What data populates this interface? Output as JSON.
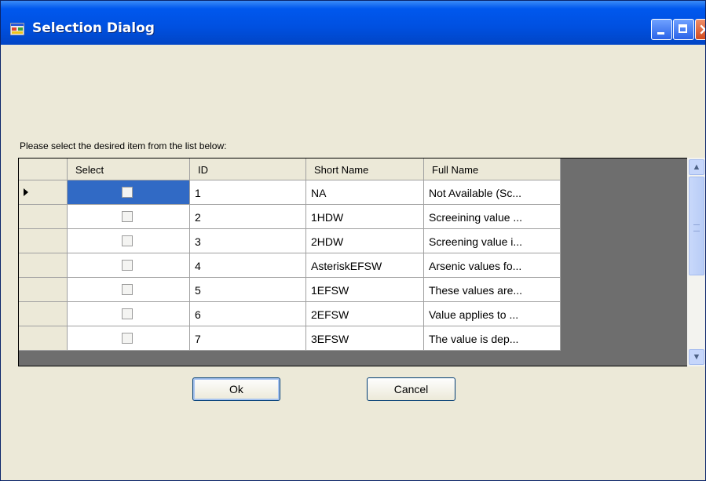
{
  "window": {
    "title": "Selection Dialog",
    "icon": "application-icon"
  },
  "prompt": "Please select the desired item from the list below:",
  "grid": {
    "columns": [
      "Select",
      "ID",
      "Short Name",
      "Full Name"
    ],
    "rows": [
      {
        "selected_row": true,
        "checked": false,
        "id": "1",
        "short_name": "NA",
        "full_name": "Not Available (Sc..."
      },
      {
        "selected_row": false,
        "checked": false,
        "id": "2",
        "short_name": "1HDW",
        "full_name": "Screeining value ..."
      },
      {
        "selected_row": false,
        "checked": false,
        "id": "3",
        "short_name": "2HDW",
        "full_name": "Screening value i..."
      },
      {
        "selected_row": false,
        "checked": false,
        "id": "4",
        "short_name": "AsteriskEFSW",
        "full_name": "Arsenic values fo..."
      },
      {
        "selected_row": false,
        "checked": false,
        "id": "5",
        "short_name": "1EFSW",
        "full_name": "These values are..."
      },
      {
        "selected_row": false,
        "checked": false,
        "id": "6",
        "short_name": "2EFSW",
        "full_name": "Value applies to ..."
      },
      {
        "selected_row": false,
        "checked": false,
        "id": "7",
        "short_name": "3EFSW",
        "full_name": "The value is dep..."
      }
    ]
  },
  "buttons": {
    "ok": "Ok",
    "cancel": "Cancel"
  },
  "colors": {
    "titlebar": "#0058ee",
    "selection": "#316ac5",
    "grid_background": "#6e6e6e",
    "dialog_background": "#ece9d8"
  }
}
